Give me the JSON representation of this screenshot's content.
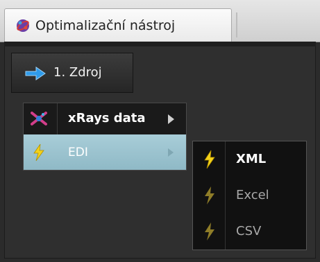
{
  "tab": {
    "label": "Optimalizační nástroj",
    "icon": "optimizer-globe-icon"
  },
  "step": {
    "label": "1. Zdroj",
    "icon": "arrow-right-icon"
  },
  "source_menu": {
    "items": [
      {
        "label": "xRays data",
        "icon": "xrays-icon",
        "has_submenu": true
      },
      {
        "label": "EDI",
        "icon": "lightning-icon",
        "has_submenu": true,
        "highlighted": true
      }
    ]
  },
  "edi_submenu": {
    "items": [
      {
        "label": "XML",
        "icon": "lightning-icon",
        "enabled": true
      },
      {
        "label": "Excel",
        "icon": "lightning-icon",
        "enabled": false
      },
      {
        "label": "CSV",
        "icon": "lightning-icon",
        "enabled": false
      }
    ]
  },
  "colors": {
    "highlight": "#9cc3cf",
    "lightning_enabled": "#f4d21a",
    "lightning_disabled": "#8f7d28",
    "arrow_blue": "#2f9bea"
  }
}
